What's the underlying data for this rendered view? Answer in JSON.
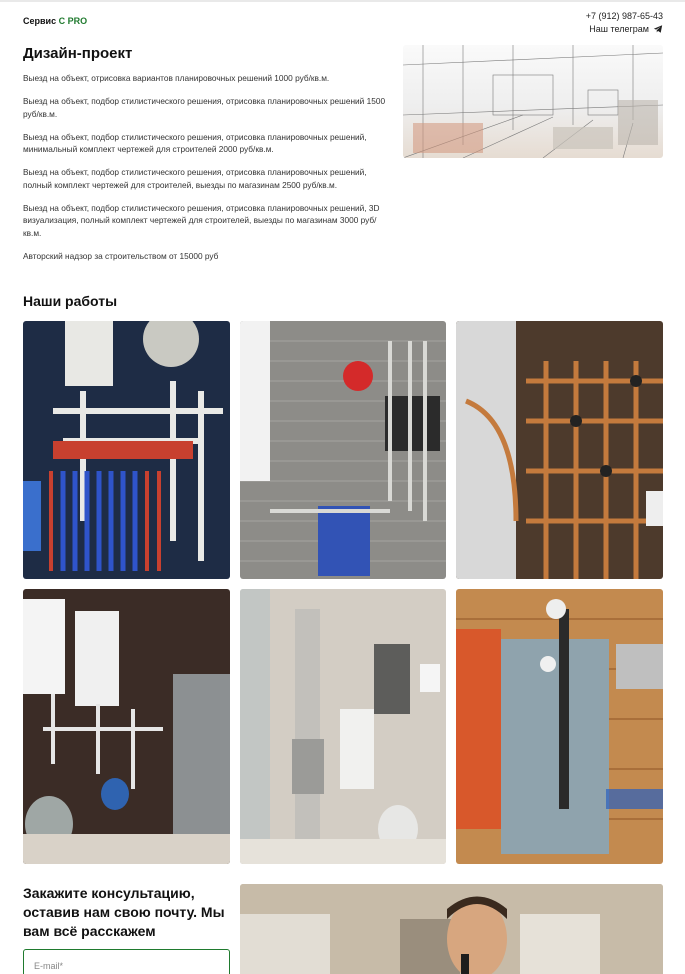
{
  "header": {
    "logo_main": "Сервис ",
    "logo_accent": "С PRO",
    "phone": "+7 (912) 987-65-43",
    "telegram_label": "Наш телеграм"
  },
  "design": {
    "title": "Дизайн-проект",
    "items": [
      "Выезд на объект, отрисовка вариантов планировочных решений 1000 руб/кв.м.",
      "Выезд на объект, подбор стилистического решения, отрисовка планировочных решений 1500 руб/кв.м.",
      "Выезд на объект, подбор стилистического решения, отрисовка планировочных решений, минимальный комплект чертежей для строителей 2000 руб/кв.м.",
      "Выезд на объект, подбор стилистического решения, отрисовка планировочных решений, полный комплект чертежей для строителей, выезды по магазинам 2500 руб/кв.м.",
      "Выезд на объект, подбор стилистического решения, отрисовка планировочных решений, 3D визуализация, полный комплект чертежей для строителей, выезды по магазинам 3000 руб/кв.м.",
      "Авторский надзор за строительством от 15000 руб"
    ]
  },
  "works": {
    "title": "Наши работы"
  },
  "cta": {
    "title": "Закажите консультацию, оставив нам свою почту. Мы вам всё расскажем",
    "email_placeholder": "E-mail*"
  },
  "colors": {
    "accent": "#1f7a2e"
  }
}
